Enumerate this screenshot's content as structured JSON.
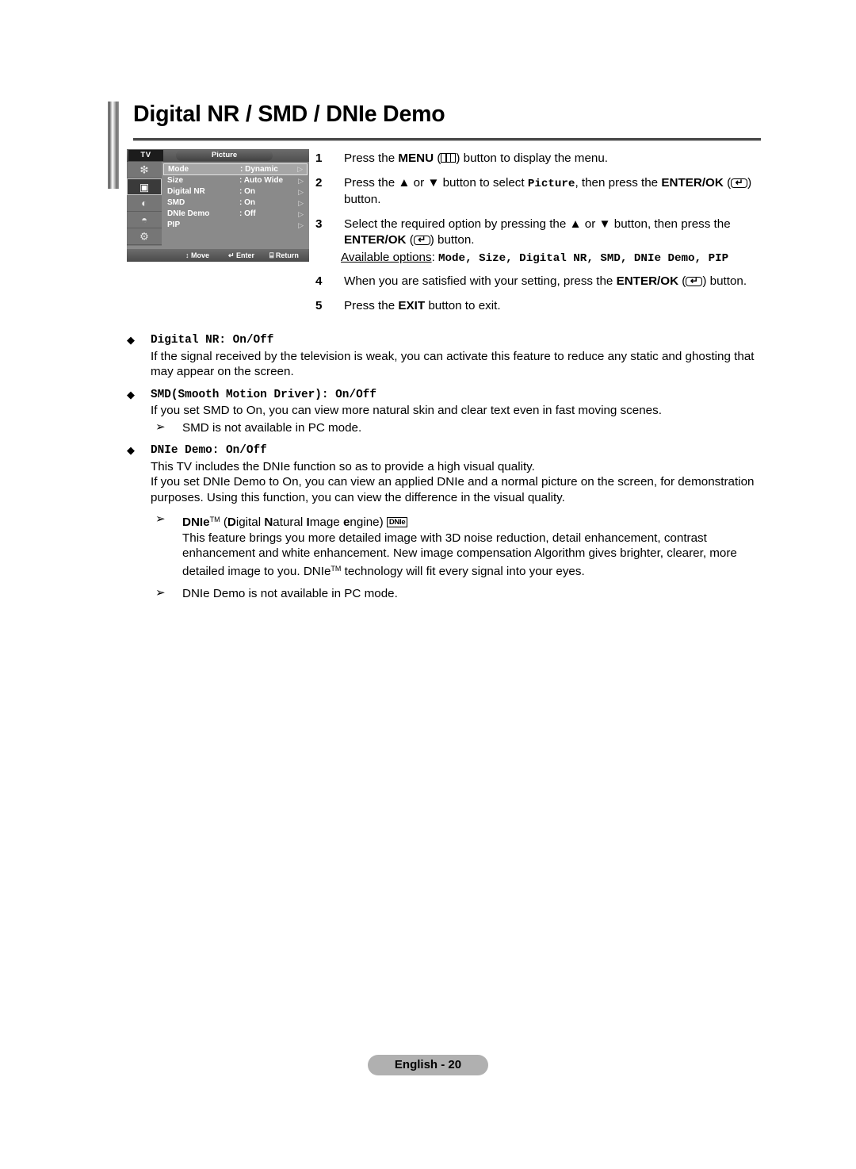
{
  "page": {
    "title": "Digital NR / SMD / DNIe Demo",
    "footer_label": "English - 20"
  },
  "osd": {
    "source_label": "TV",
    "menu_title": "Picture",
    "sidebar_icons": [
      {
        "name": "input-source-icon",
        "glyph": "❇"
      },
      {
        "name": "picture-icon",
        "glyph": "▣"
      },
      {
        "name": "sound-icon",
        "glyph": "◐"
      },
      {
        "name": "channel-icon",
        "glyph": "◓"
      },
      {
        "name": "setup-icon",
        "glyph": "⚙"
      }
    ],
    "rows": [
      {
        "label": "Mode",
        "value": ": Dynamic",
        "arrow": "▷",
        "highlighted": true
      },
      {
        "label": "Size",
        "value": ": Auto Wide",
        "arrow": "▷",
        "highlighted": false
      },
      {
        "label": "Digital NR",
        "value": ": On",
        "arrow": "▷",
        "highlighted": false
      },
      {
        "label": "SMD",
        "value": ": On",
        "arrow": "▷",
        "highlighted": false
      },
      {
        "label": "DNIe Demo",
        "value": ": Off",
        "arrow": "▷",
        "highlighted": false
      },
      {
        "label": "PIP",
        "value": "",
        "arrow": "▷",
        "highlighted": false
      }
    ],
    "bottom_bar": {
      "move": "↕ Move",
      "enter": "↵ Enter",
      "return": "⌸ Return"
    }
  },
  "steps": {
    "s1_num": "1",
    "s1_a": "Press the ",
    "s1_menu": "MENU",
    "s1_b": ") button to display the menu.",
    "s2_num": "2",
    "s2_a": "Press the ▲ or ▼ button to select ",
    "s2_mono": "Picture",
    "s2_b": ", then press the ",
    "s2_enterok": "ENTER/OK",
    "s2_c": ") button.",
    "s3_num": "3",
    "s3_a": "Select the required option by pressing the ▲ or ▼ button, then press the ",
    "s3_enterok": "ENTER/OK",
    "s3_b": ") button.",
    "available_label": "Available options",
    "available_colon": ": ",
    "available_options": "Mode, Size, Digital NR, SMD, DNIe Demo, PIP",
    "s4_num": "4",
    "s4_a": "When you are satisfied with your setting, press the ",
    "s4_enterok": "ENTER/OK",
    "s4_b": ") button.",
    "s5_num": "5",
    "s5_a": "Press the ",
    "s5_exit": "EXIT",
    "s5_b": " button to exit."
  },
  "sections": {
    "bullet_glyph": "◆",
    "arrow_glyph": "➢",
    "digital_nr": {
      "head": "Digital NR: On/Off",
      "body": "If the signal received by the television is weak, you can activate this feature to reduce any static and ghosting that may appear on the screen."
    },
    "smd": {
      "head": "SMD(Smooth Motion Driver): On/Off",
      "body": "If you set SMD to On, you can view more natural skin and clear text even in fast moving scenes.",
      "note": "SMD is not available in PC mode."
    },
    "dnie_demo": {
      "head": "DNIe Demo: On/Off",
      "body1": "This TV includes the DNIe function so as to provide a high visual quality.",
      "body2": "If you set DNIe Demo to On, you can view an applied DNIe and a normal picture on the screen, for demonstration purposes. Using this function, you can view the difference in the visual quality.",
      "sub_title_bold": "DNIe",
      "sub_title_tm": "TM",
      "sub_title_rest_open": " (",
      "sub_d": "D",
      "sub_igital": "igital ",
      "sub_n": "N",
      "sub_atural": "atural ",
      "sub_i": "I",
      "sub_mage": "mage ",
      "sub_e": "e",
      "sub_ngine": "ngine)",
      "badge": "DNIe",
      "sub_body_a": "This feature brings you more detailed image with 3D noise reduction, detail enhancement, contrast enhancement and white enhancement. New image compensation Algorithm gives brighter, clearer, more detailed image to you. DNIe",
      "sub_body_b": " technology will fit every signal into your eyes.",
      "note": "DNIe Demo is not available in PC mode."
    }
  }
}
